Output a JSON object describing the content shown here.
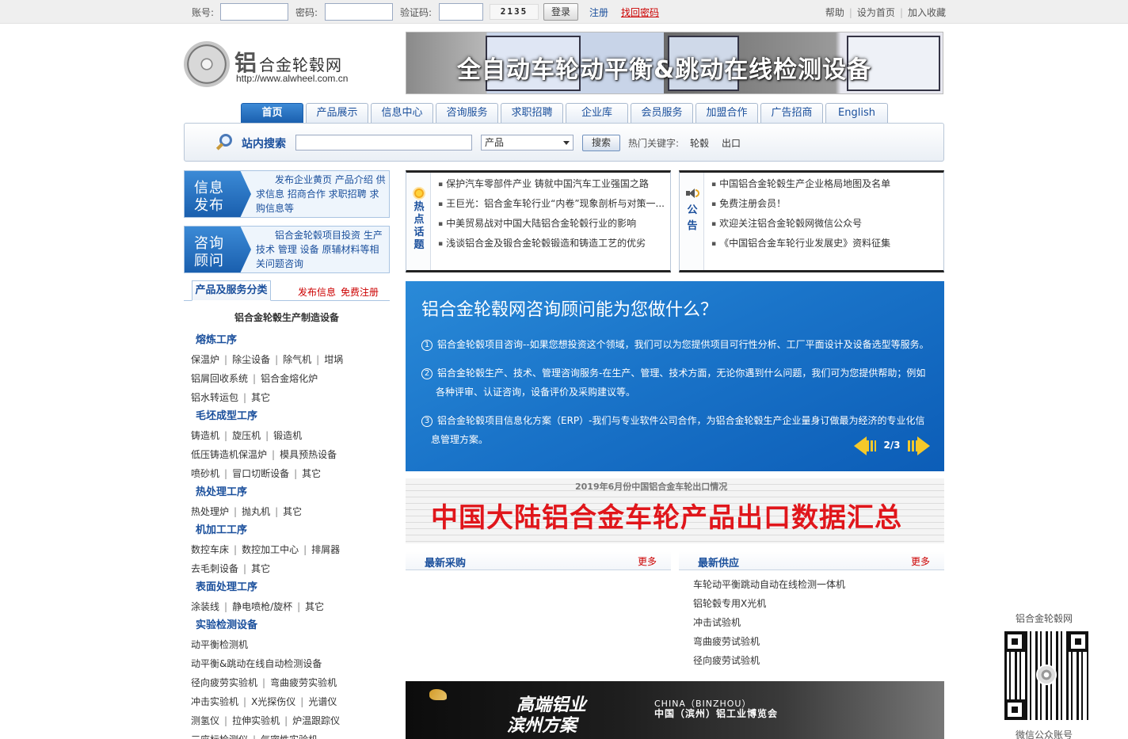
{
  "topbar": {
    "account_label": "账号:",
    "password_label": "密码:",
    "captcha_label": "验证码:",
    "captcha_value": "2135",
    "login_label": "登录",
    "register_label": "注册",
    "forgot_label": "找回密码",
    "right_links": [
      "帮助",
      "设为首页",
      "加入收藏"
    ]
  },
  "logo": {
    "char": "铝",
    "title": "合金轮毂网",
    "url": "http://www.alwheel.com.cn"
  },
  "banner": {
    "text": "全自动车轮动平衡&跳动在线检测设备"
  },
  "nav": {
    "tabs": [
      "首页",
      "产品展示",
      "信息中心",
      "咨询服务",
      "求职招聘",
      "企业库",
      "会员服务",
      "加盟合作",
      "广告招商",
      "English"
    ],
    "active_index": 0
  },
  "search": {
    "title": "站内搜索",
    "select_value": "产品",
    "button_label": "搜索",
    "hot_label": "热门关键字:",
    "hot_keywords": [
      "轮毂",
      "出口"
    ]
  },
  "info_publish": {
    "badge_line1": "信息",
    "badge_line2": "发布",
    "desc": "发布企业黄页 产品介绍 供求信息 招商合作 求职招聘 求购信息等"
  },
  "consult_advisor": {
    "badge_line1": "咨询",
    "badge_line2": "顾问",
    "desc": "铝合金轮毂项目投资 生产 技术 管理 设备 原辅材料等相关问题咨询"
  },
  "category": {
    "tab_label": "产品及服务分类",
    "publish_link": "发布信息",
    "register_link": "免费注册",
    "heading": "铝合金轮毂生产制造设备",
    "groups": [
      {
        "title": "熔炼工序",
        "rows": [
          [
            "保温炉",
            "除尘设备",
            "除气机",
            "坩埚"
          ],
          [
            "铝屑回收系统",
            "铝合金熔化炉"
          ],
          [
            "铝水转运包",
            "其它"
          ]
        ]
      },
      {
        "title": "毛坯成型工序",
        "rows": [
          [
            "铸造机",
            "旋压机",
            "锻造机"
          ],
          [
            "低压铸造机保温炉",
            "模具预热设备"
          ],
          [
            "喷砂机",
            "冒口切断设备",
            "其它"
          ]
        ]
      },
      {
        "title": "热处理工序",
        "rows": [
          [
            "热处理炉",
            "抛丸机",
            "其它"
          ]
        ]
      },
      {
        "title": "机加工工序",
        "rows": [
          [
            "数控车床",
            "数控加工中心",
            "排屑器"
          ],
          [
            "去毛刺设备",
            "其它"
          ]
        ]
      },
      {
        "title": "表面处理工序",
        "rows": [
          [
            "涂装线",
            "静电喷枪/旋杯",
            "其它"
          ]
        ]
      },
      {
        "title": "实验检测设备",
        "rows": [
          [
            "动平衡检测机"
          ],
          [
            "动平衡&跳动在线自动检测设备"
          ],
          [
            "径向疲劳实验机",
            "弯曲疲劳实验机"
          ],
          [
            "冲击实验机",
            "X光探伤仪",
            "光谱仪"
          ],
          [
            "测氢仪",
            "拉伸实验机",
            "炉温跟踪仪"
          ],
          [
            "三座标检测仪",
            "气密性实验机"
          ]
        ]
      }
    ]
  },
  "hot_topics": {
    "label": "热点话题",
    "items": [
      "保护汽车零部件产业 铸就中国汽车工业强国之路",
      "王巨光：铝合金车轮行业“内卷”现象剖析与对策一...",
      "中美贸易战对中国大陆铝合金轮毂行业的影响",
      "浅谈铝合金及锻合金轮毂锻造和铸造工艺的优劣"
    ]
  },
  "notices": {
    "label": "公告",
    "items": [
      "中国铝合金轮毂生产企业格局地图及名单",
      "免费注册会员！",
      "欢迎关注铝合金轮毂网微信公众号",
      "《中国铝合金车轮行业发展史》资料征集"
    ]
  },
  "consult_panel": {
    "title": "铝合金轮毂网咨询顾问能为您做什么？",
    "items": [
      {
        "num": "1",
        "text": "铝合金轮毂项目咨询--如果您想投资这个领域，我们可以为您提供项目可行性分析、工厂平面设计及设备选型等服务。"
      },
      {
        "num": "2",
        "text": "铝合金轮毂生产、技术、管理咨询服务-在生产、管理、技术方面，无论你遇到什么问题，我们可为您提供帮助；例如各种评审、认证咨询，设备评价及采购建议等。"
      },
      {
        "num": "3",
        "text": "铝合金轮毂项目信息化方案（ERP）-我们与专业软件公司合作，为铝合金轮毂生产企业量身订做最为经济的专业化信息管理方案。"
      }
    ],
    "pager": "2/3"
  },
  "export_banner": {
    "subtitle": "2019年6月份中国铝合金车轮出口情况",
    "title": "中国大陆铝合金车轮产品出口数据汇总"
  },
  "latest_purchase": {
    "title": "最新采购",
    "more": "更多"
  },
  "latest_supply": {
    "title": "最新供应",
    "more": "更多",
    "items": [
      "车轮动平衡跳动自动在线检测一体机",
      "铝轮毂专用X光机",
      "冲击试验机",
      "弯曲疲劳试验机",
      "径向疲劳试验机"
    ]
  },
  "expo_banner": {
    "slogan_line1": "高端铝业",
    "slogan_line2": "滨州方案",
    "en_title": "CHINA（BINZHOU）",
    "cn_title": "中国（滨州）铝工业博览会"
  },
  "qr": {
    "title": "铝合金轮毂网",
    "footer": "微信公众账号"
  }
}
